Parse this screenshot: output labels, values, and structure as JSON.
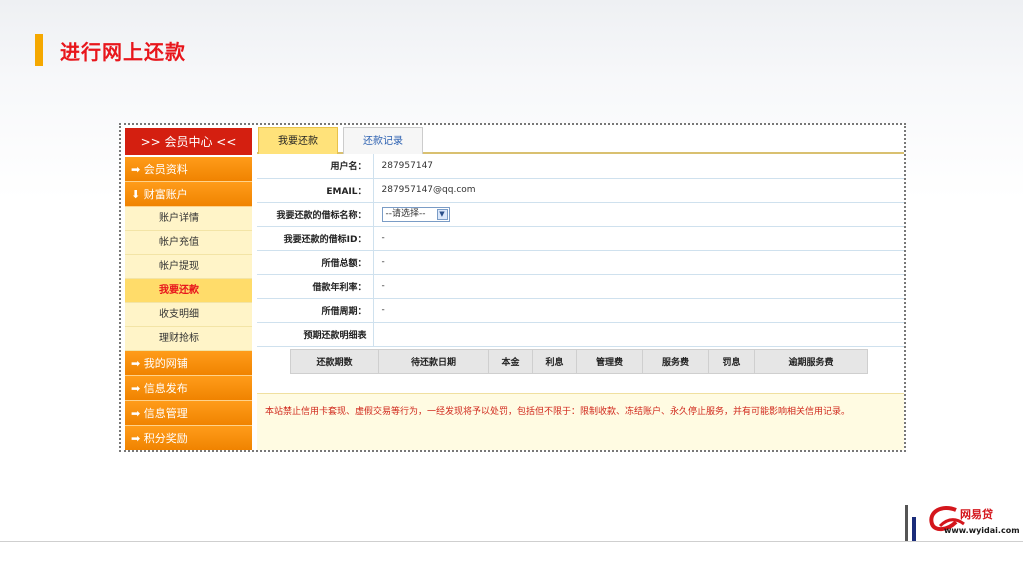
{
  "slide": {
    "title": "进行网上还款"
  },
  "sidebar": {
    "header": ">> 会员中心 <<",
    "sections": [
      {
        "label": "➡ 会员资料"
      },
      {
        "label": "⬇ 财富账户"
      }
    ],
    "subitems": [
      "账户详情",
      "帐户充值",
      "帐户提现",
      "我要还款",
      "收支明细",
      "理财抢标"
    ],
    "more_sections": [
      {
        "label": "➡ 我的网铺"
      },
      {
        "label": "➡ 信息发布"
      },
      {
        "label": "➡ 信息管理"
      },
      {
        "label": "➡ 积分奖励"
      }
    ]
  },
  "tabs": {
    "active": "我要还款",
    "inactive": "还款记录"
  },
  "form": {
    "username_label": "用户名：",
    "username_value": "287957147",
    "email_label": "EMAIL：",
    "email_value": "287957147@qq.com",
    "loan_name_label": "我要还款的借标名称：",
    "loan_name_select": "--请选择--",
    "loan_id_label": "我要还款的借标ID：",
    "loan_id_value": "-",
    "total_label": "所借总额：",
    "total_value": "-",
    "rate_label": "借款年利率：",
    "rate_value": "-",
    "period_label": "所借周期：",
    "period_value": "-",
    "schedule_label": "预期还款明细表"
  },
  "schedule_columns": [
    "还款期数",
    "待还款日期",
    "本金",
    "利息",
    "管理费",
    "服务费",
    "罚息",
    "逾期服务费"
  ],
  "notice": "本站禁止信用卡套现、虚假交易等行为，一经发现将予以处罚，包括但不限于：限制收款、冻结账户、永久停止服务，并有可能影响相关信用记录。",
  "logo": {
    "name": "网易贷",
    "site": "www.wyidai.com"
  },
  "colors": {
    "title_red": "#e8161c",
    "accent_orange": "#f08300",
    "sidebar_head": "#d41f10"
  }
}
